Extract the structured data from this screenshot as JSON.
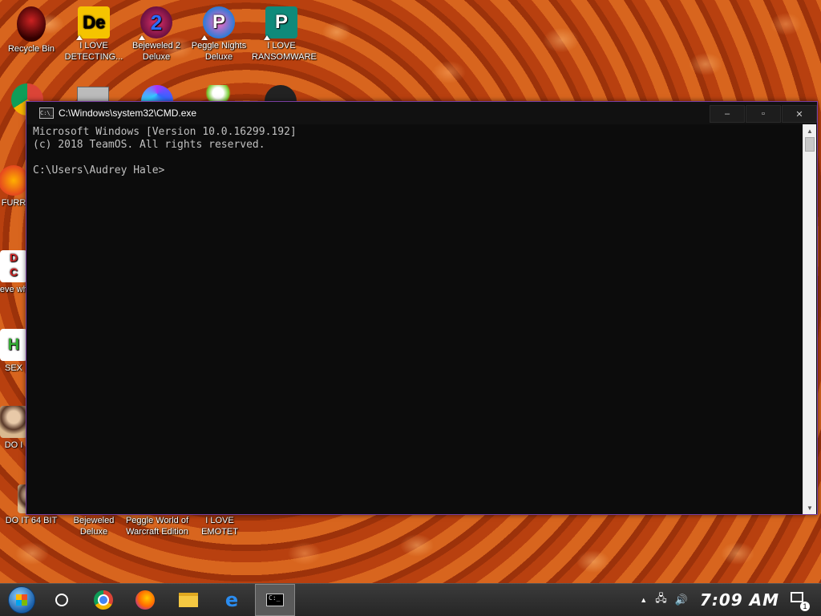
{
  "desktop": {
    "icons_top": [
      {
        "label": "Recycle Bin",
        "icon": "recycle-bin-icon"
      },
      {
        "label": "I LOVE DETECTING...",
        "icon": "detect-it-easy-icon"
      },
      {
        "label": "Bejeweled 2 Deluxe",
        "icon": "bejeweled-2-icon"
      },
      {
        "label": "Peggle Nights Deluxe",
        "icon": "peggle-nights-icon"
      },
      {
        "label": "I LOVE RANSOMWARE",
        "icon": "publisher-icon"
      }
    ],
    "icons_left": [
      {
        "label": "FURR",
        "icon": "firefox-icon"
      },
      {
        "label": "neve why",
        "icon": "app-icon"
      },
      {
        "label": "SEX",
        "icon": "notepad-icon"
      },
      {
        "label": "DO I",
        "icon": "portrait-icon"
      }
    ],
    "icons_bottom": [
      {
        "label": "DO IT 64 BIT",
        "icon": "portrait-icon"
      },
      {
        "label": "Bejeweled Deluxe",
        "icon": "bejeweled-icon"
      },
      {
        "label": "Peggle World of Warcraft Edition",
        "icon": "peggle-wow-icon"
      },
      {
        "label": "I LOVE EMOTET",
        "icon": "app-icon"
      }
    ]
  },
  "cmd": {
    "title": "C:\\Windows\\system32\\CMD.exe",
    "app_icon_text": "C:\\_",
    "minimize": "–",
    "maximize": "▫",
    "close": "✕",
    "output": "Microsoft Windows [Version 10.0.16299.192]\n(c) 2018 TeamOS. All rights reserved.\n\nC:\\Users\\Audrey Hale>"
  },
  "taskbar": {
    "items": [
      {
        "name": "start-button",
        "icon": "windows-logo"
      },
      {
        "name": "search-button",
        "icon": "circle"
      },
      {
        "name": "chrome",
        "icon": "chrome-icon"
      },
      {
        "name": "firefox",
        "icon": "firefox-icon"
      },
      {
        "name": "file-explorer",
        "icon": "folder-icon"
      },
      {
        "name": "edge",
        "icon": "edge-icon"
      },
      {
        "name": "cmd",
        "icon": "cmd-icon"
      }
    ],
    "clock": "7:09 AM",
    "notification_count": "1"
  },
  "colors": {
    "window_border": "#7a3fa0",
    "console_bg": "#0c0c0c",
    "console_text": "#c0c0c0"
  }
}
